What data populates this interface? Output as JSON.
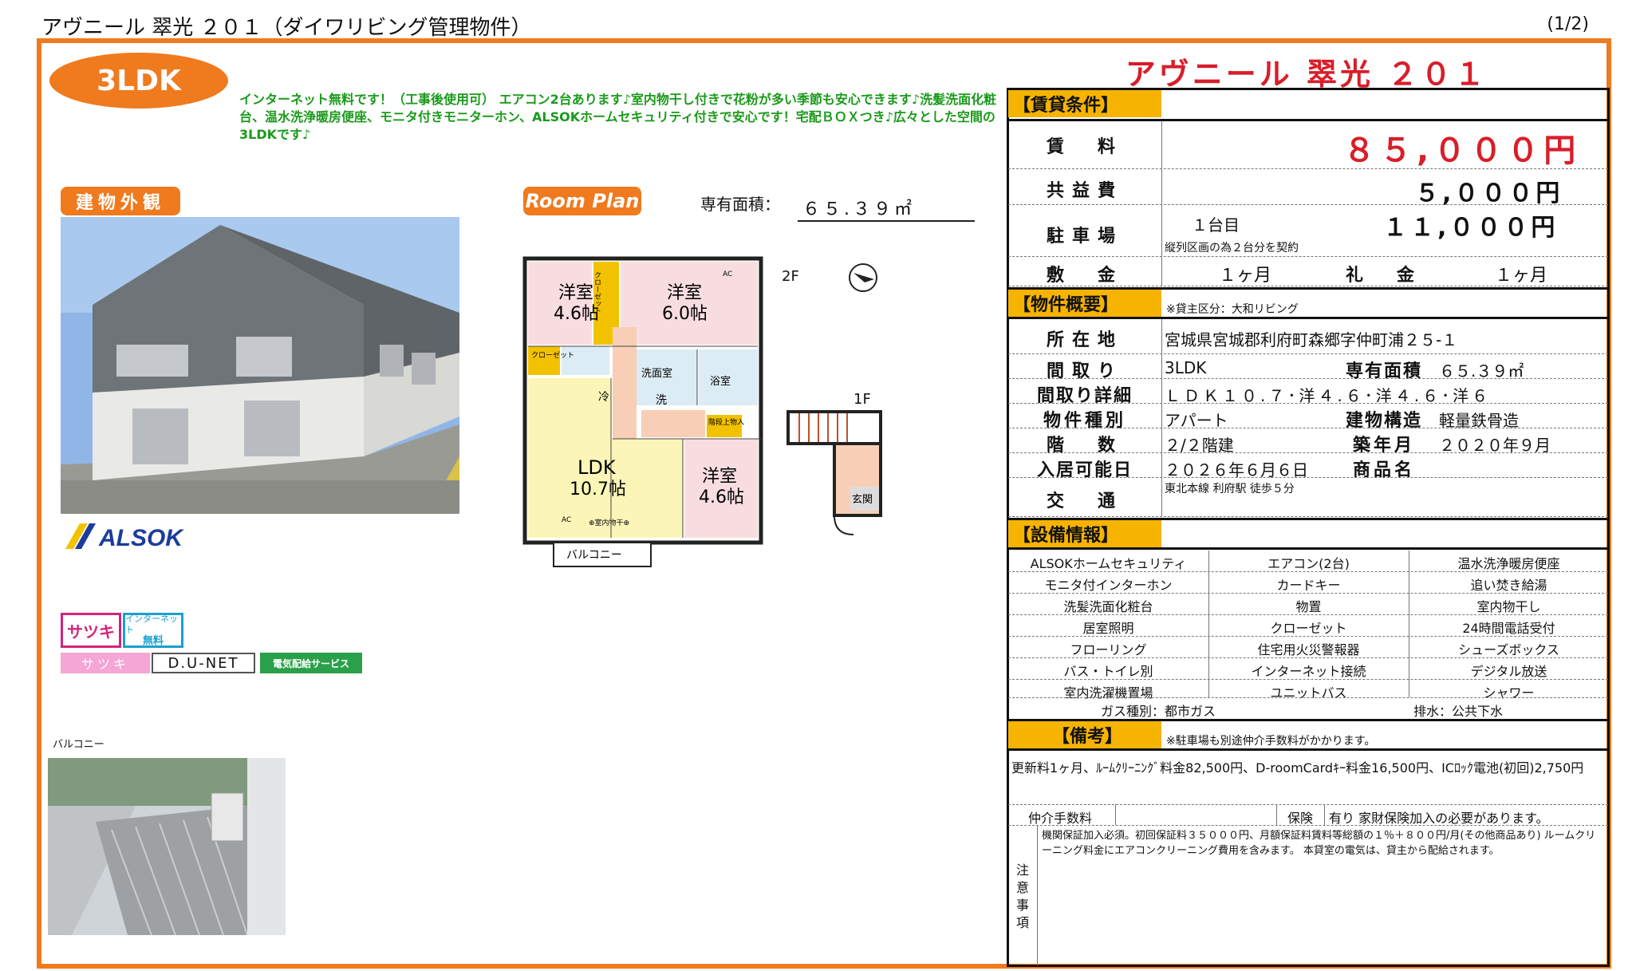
{
  "header": {
    "title": "アヴニール 翠光 ２０１（ダイワリビング管理物件）",
    "page": "(1/2)"
  },
  "badge": {
    "layout": "3LDK"
  },
  "description": "インターネット無料です！（工事後使用可） エアコン2台あります♪室内物干し付きで花粉が多い季節も安心できます♪洗髪洗面化粧台、温水洗浄暖房便座、モニタ付きモニターホン、ALSOKホームセキュリティ付きで安心です！宅配ＢＯＸつき♪広々とした空間の3LDKです♪",
  "left": {
    "exterior_label": "建物外観",
    "roomplan_label": "Room Plan",
    "area_label": "専有面積：",
    "area_value": "６５.３９㎡",
    "logos": {
      "alsok": "ALSOK",
      "satsuki": "サツキ",
      "inet_top": "インターネット",
      "inet_bottom": "無料",
      "satsuki_bar": "サツキ",
      "dunet": "D.U-NET",
      "denki": "電気配給サービス"
    },
    "balcony_caption": "バルコニー"
  },
  "plan": {
    "floor2": "2F",
    "floor1": "1F",
    "room_w1": "洋室",
    "room_w1_size": "4.6帖",
    "room_w2": "洋室",
    "room_w2_size": "6.0帖",
    "room_w3": "洋室",
    "room_w3_size": "4.6帖",
    "ldk": "LDK",
    "ldk_size": "10.7帖",
    "closet1": "クローゼット",
    "closet2": "クローゼット",
    "washroom": "洗面室",
    "bath": "浴室",
    "fridge": "冷",
    "wash": "洗",
    "stairs_note": "階段上物入",
    "entrance": "玄関",
    "balcony": "バルコニー",
    "indoor_dry": "⊕室内物干⊕",
    "ac1": "AC",
    "ac2": "AC"
  },
  "property": {
    "name": "アヴニール 翠光 ２０１",
    "sections": {
      "rent": "【賃貸条件】",
      "overview": "【物件概要】",
      "equipment": "【設備情報】",
      "remarks": "【備考】"
    },
    "rent_label": "賃　料",
    "rent_value": "８５,０００円",
    "common_label": "共益費",
    "common_value": "５,０００円",
    "parking_label": "駐車場",
    "parking_count": "１台目",
    "parking_value": "１１,０００円",
    "parking_note": "縦列区画の為２台分を契約",
    "deposit_label": "敷　金",
    "deposit_value": "１ヶ月",
    "key_label": "礼　金",
    "key_value": "１ヶ月",
    "owner_note": "※貸主区分：大和リビング",
    "address_label": "所在地",
    "address_value": "宮城県宮城郡利府町森郷字仲町浦２５-１",
    "layout_label": "間取り",
    "layout_value": "3LDK",
    "area_label": "専有面積",
    "area_value": "６５.３９㎡",
    "detail_label": "間取り詳細",
    "detail_value": "ＬＤＫ１０.７･洋４.６･洋４.６･洋６",
    "type_label": "物件種別",
    "type_value": "アパート",
    "struct_label": "建物構造",
    "struct_value": "軽量鉄骨造",
    "floor_label": "階　数",
    "floor_value": "２/２階建",
    "built_label": "築年月",
    "built_value": "２０２０年９月",
    "movein_label": "入居可能日",
    "movein_value": "２０２６年６月６日",
    "product_label": "商品名",
    "product_value": "",
    "traffic_label": "交　通",
    "traffic_value": "東北本線 利府駅 徒歩５分",
    "equipment": [
      [
        "ALSOKホームセキュリティ",
        "エアコン(2台)",
        "温水洗浄暖房便座"
      ],
      [
        "モニタ付インターホン",
        "カードキー",
        "追い焚き給湯"
      ],
      [
        "洗髪洗面化粧台",
        "物置",
        "室内物干し"
      ],
      [
        "居室照明",
        "クローゼット",
        "24時間電話受付"
      ],
      [
        "フローリング",
        "住宅用火災警報器",
        "シューズボックス"
      ],
      [
        "バス・トイレ別",
        "インターネット接続",
        "デジタル放送"
      ],
      [
        "室内洗濯機置場",
        "ユニットバス",
        "シャワー"
      ]
    ],
    "gas": "ガス種別：都市ガス",
    "drain": "排水：公共下水",
    "remarks_note": "※駐車場も別途仲介手数料がかかります。",
    "remarks_text": "更新料1ヶ月、ﾙｰﾑｸﾘｰﾆﾝｸﾞ料金82,500円、D-roomCardｷｰ料金16,500円、ICﾛｯｸ電池(初回)2,750円",
    "broker_label": "仲介手数料",
    "broker_value": "",
    "insurance_label": "保険",
    "insurance_value": "有り 家財保険加入の必要があります。",
    "notes_label": "注意事項",
    "notes_text": "機関保証加入必須。初回保証料３５０００円、月額保証料賃料等総額の１％＋８００円/月(その他商品あり) ルームクリーニング料金にエアコンクリーニング費用を含みます。 本貸室の電気は、貸主から配給されます。"
  },
  "colors": {
    "accent": "#f07a1e",
    "section": "#f6b300",
    "price": "#d81e2a",
    "desc": "#1a9a1a"
  }
}
